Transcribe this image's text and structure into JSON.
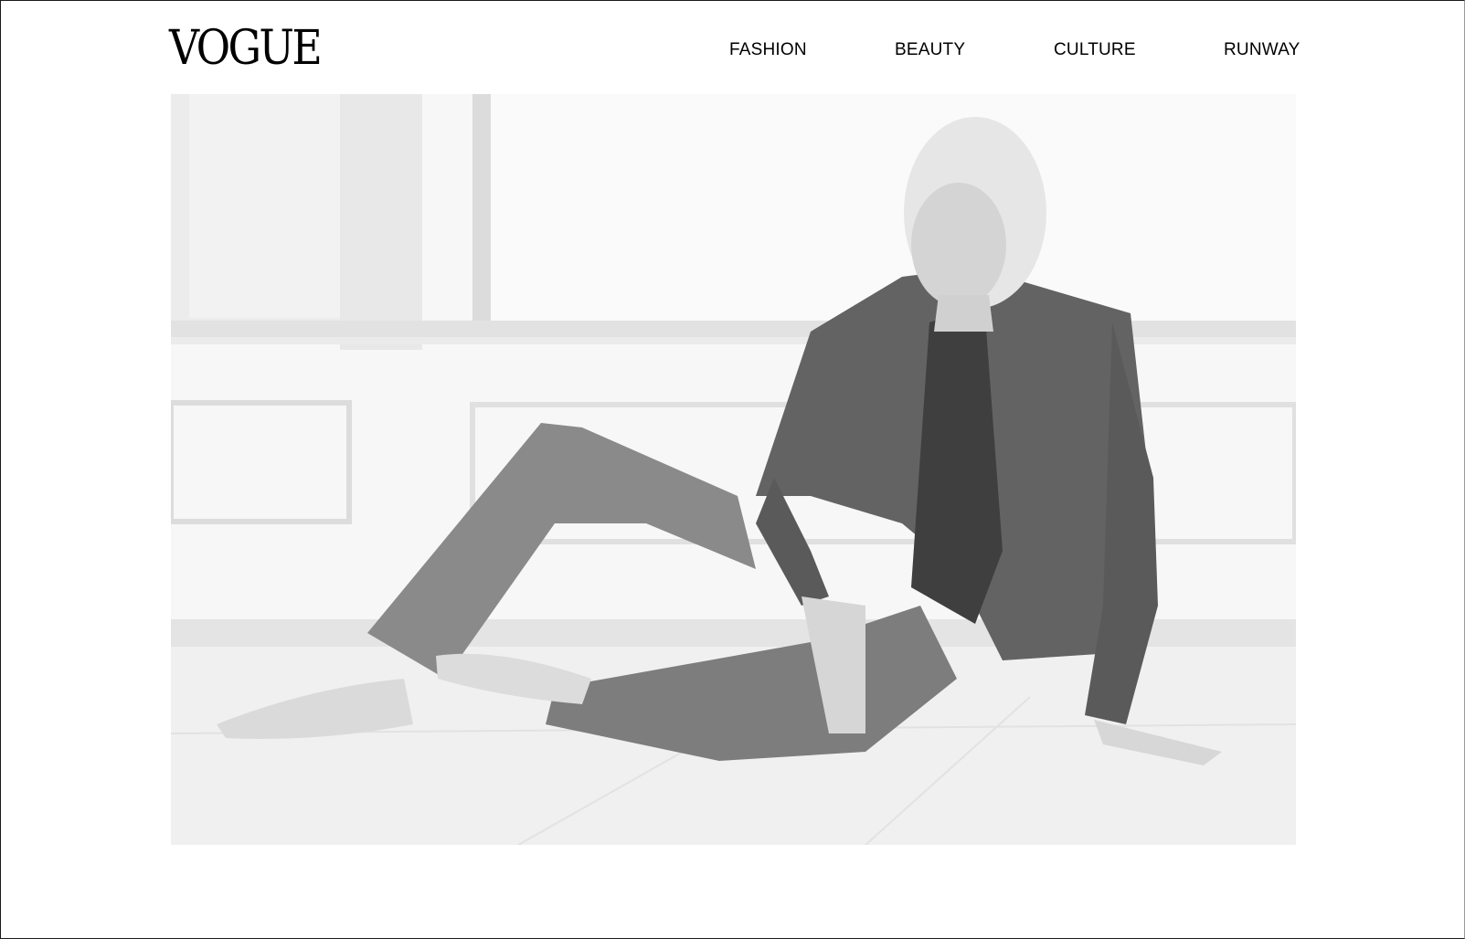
{
  "header": {
    "logo_text": "VOGUE",
    "nav": [
      {
        "label": "FASHION"
      },
      {
        "label": "BEAUTY"
      },
      {
        "label": "CULTURE"
      },
      {
        "label": "RUNWAY"
      }
    ]
  },
  "hero": {
    "image_description_icon": "hero-photo",
    "palette": {
      "wall": "#f6f6f6",
      "floor": "#f3f3f3",
      "jacket": "#5f5f5f",
      "jeans": "#7a7a7a",
      "skin": "#d9d9d9",
      "hair": "#e9e9e9"
    }
  }
}
